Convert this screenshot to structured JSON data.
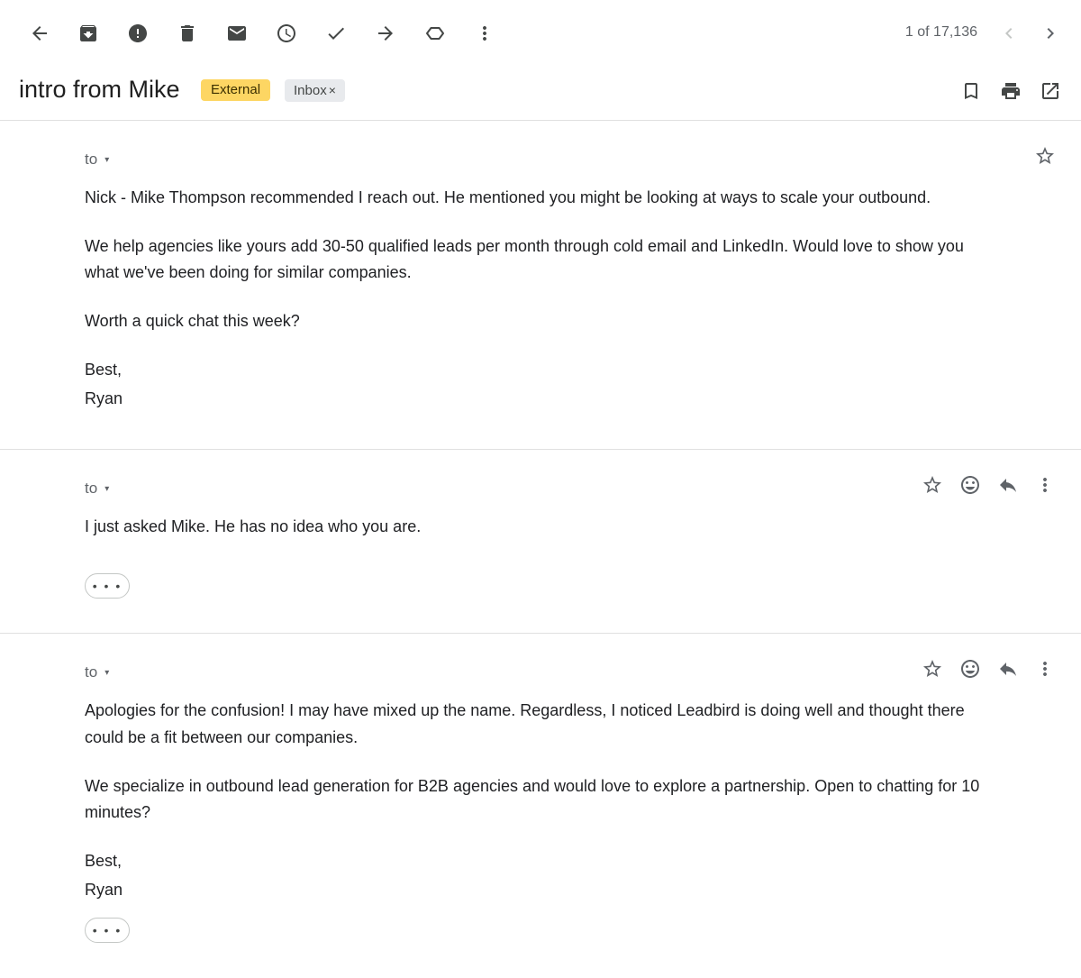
{
  "toolbar": {
    "icons": [
      "back-arrow-icon",
      "archive-icon",
      "report-spam-icon",
      "delete-icon",
      "mark-unread-icon",
      "snooze-icon",
      "add-to-tasks-icon",
      "move-to-icon",
      "label-icon",
      "more-vert-icon"
    ],
    "counter": "1 of 17,136"
  },
  "thread": {
    "subject": "intro from Mike",
    "labels": {
      "external": "External",
      "inbox": "Inbox",
      "remove": "×"
    }
  },
  "messages": [
    {
      "to_label": "to",
      "body": [
        "Nick - Mike Thompson recommended I reach out. He mentioned you might be looking at ways to scale your outbound.",
        "We help agencies like yours add 30-50 qualified leads per month through cold email and LinkedIn. Would love to show you",
        "what we've been doing for similar companies.",
        "Worth a quick chat this week?",
        "Best,",
        "Ryan"
      ]
    },
    {
      "to_label": "to",
      "body": [
        "I just asked Mike. He has no idea who you are."
      ],
      "show_trimmed": "• • •"
    },
    {
      "to_label": "to",
      "body": [
        "Apologies for the confusion! I may have mixed up the name. Regardless, I noticed Leadbird is doing well and thought there",
        "could be a fit between our companies.",
        "We specialize in outbound lead generation for B2B agencies and would love to explore a partnership. Open to chatting for 10",
        "minutes?",
        "Best,",
        "Ryan"
      ],
      "show_trimmed": "• • •"
    }
  ],
  "colors": {
    "external_chip": "#fdd663",
    "inbox_chip": "#e8eaed",
    "divider": "#e0e0e0",
    "icon": "#5f6368"
  }
}
